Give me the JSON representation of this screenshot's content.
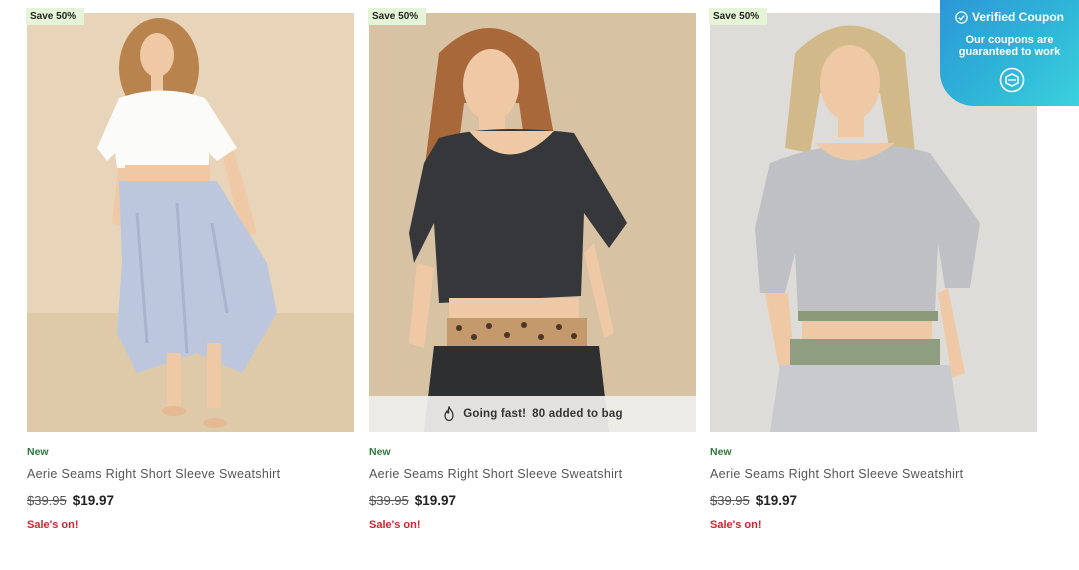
{
  "coupon": {
    "title": "Verified Coupon",
    "line1": "Our coupons are",
    "line2": "guaranteed to work",
    "check_icon": "check-circle-icon",
    "logo_icon": "coupon-logo-icon"
  },
  "products": [
    {
      "badge": "Save 50%",
      "new_label": "New",
      "title": "Aerie Seams Right Short Sleeve Sweatshirt",
      "old_price": "$39.95",
      "price": "$19.97",
      "sale": "Sale's on!"
    },
    {
      "badge": "Save 50%",
      "new_label": "New",
      "title": "Aerie Seams Right Short Sleeve Sweatshirt",
      "old_price": "$39.95",
      "price": "$19.97",
      "sale": "Sale's on!",
      "going_fast": "Going fast!",
      "added": "80 added to bag"
    },
    {
      "badge": "Save 50%",
      "new_label": "New",
      "title": "Aerie Seams Right Short Sleeve Sweatshirt",
      "old_price": "$39.95",
      "price": "$19.97",
      "sale": "Sale's on!"
    }
  ],
  "colors": {
    "badge_bg": "#e5f4d6",
    "new_label": "#2f7a3e",
    "sale": "#d6232f",
    "coupon_bg": "#2fb5d8"
  }
}
